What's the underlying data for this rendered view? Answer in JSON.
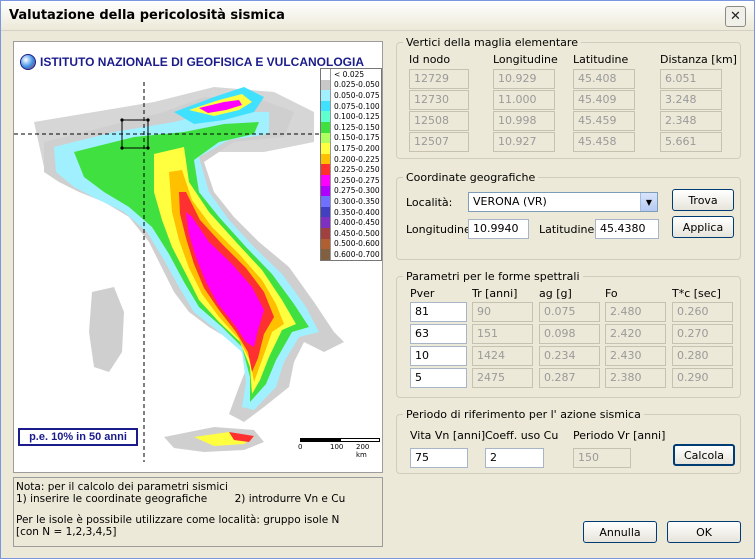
{
  "window": {
    "title": "Valutazione della pericolosità sismica"
  },
  "map": {
    "institute": "ISTITUTO NAZIONALE DI GEOFISICA E VULCANOLOGIA",
    "pe_label": "p.e. 10% in 50 anni",
    "scale_labels": [
      "0",
      "100",
      "200 km"
    ],
    "legend": [
      {
        "label": "< 0.025",
        "color": "#ffffff"
      },
      {
        "label": "0.025-0.050",
        "color": "#c8c8c8"
      },
      {
        "label": "0.050-0.075",
        "color": "#a0f0ff"
      },
      {
        "label": "0.075-0.100",
        "color": "#40e0ff"
      },
      {
        "label": "0.100-0.125",
        "color": "#60ffd0"
      },
      {
        "label": "0.125-0.150",
        "color": "#40e040"
      },
      {
        "label": "0.150-0.175",
        "color": "#b0ff60"
      },
      {
        "label": "0.175-0.200",
        "color": "#ffff40"
      },
      {
        "label": "0.200-0.225",
        "color": "#ffc000"
      },
      {
        "label": "0.225-0.250",
        "color": "#ff3030"
      },
      {
        "label": "0.250-0.275",
        "color": "#ff00ff"
      },
      {
        "label": "0.275-0.300",
        "color": "#b000ff"
      },
      {
        "label": "0.300-0.350",
        "color": "#7070ff"
      },
      {
        "label": "0.350-0.400",
        "color": "#4040c0"
      },
      {
        "label": "0.400-0.450",
        "color": "#8030c0"
      },
      {
        "label": "0.450-0.500",
        "color": "#a04040"
      },
      {
        "label": "0.500-0.600",
        "color": "#b06030"
      },
      {
        "label": "0.600-0.700",
        "color": "#806040"
      }
    ]
  },
  "note": {
    "line1": "Nota: per il calcolo dei parametri sismici",
    "line2a": "1) inserire le coordinate geografiche",
    "line2b": "2) introdurre Vn e Cu",
    "line3": "Per le isole è possibile utilizzare come località: gruppo isole N",
    "line4": "[con N = 1,2,3,4,5]"
  },
  "vertices": {
    "title": "Vertici della maglia elementare",
    "headers": [
      "Id nodo",
      "Longitudine",
      "Latitudine",
      "Distanza [km]"
    ],
    "rows": [
      [
        "12729",
        "10.929",
        "45.408",
        "6.051"
      ],
      [
        "12730",
        "11.000",
        "45.409",
        "3.248"
      ],
      [
        "12508",
        "10.998",
        "45.459",
        "2.348"
      ],
      [
        "12507",
        "10.927",
        "45.458",
        "5.661"
      ]
    ]
  },
  "coords": {
    "title": "Coordinate geografiche",
    "locality_label": "Località:",
    "locality_value": "VERONA (VR)",
    "lon_label": "Longitudine:",
    "lon_value": "10.9940",
    "lat_label": "Latitudine:",
    "lat_value": "45.4380",
    "trova": "Trova",
    "applica": "Applica"
  },
  "spectral": {
    "title": "Parametri per le forme spettrali",
    "headers": [
      "Pver",
      "Tr  [anni]",
      "ag  [g]",
      "Fo",
      "T*c  [sec]"
    ],
    "rows": [
      [
        "81",
        "90",
        "0.075",
        "2.480",
        "0.260"
      ],
      [
        "63",
        "151",
        "0.098",
        "2.420",
        "0.270"
      ],
      [
        "10",
        "1424",
        "0.234",
        "2.430",
        "0.280"
      ],
      [
        "5",
        "2475",
        "0.287",
        "2.380",
        "0.290"
      ]
    ]
  },
  "period": {
    "title": "Periodo di riferimento per l' azione sismica",
    "vn_label": "Vita Vn  [anni]",
    "cu_label": "Coeff. uso Cu",
    "vr_label": "Periodo Vr  [anni]",
    "vn_value": "75",
    "cu_value": "2",
    "vr_value": "150",
    "calcola": "Calcola"
  },
  "footer": {
    "annulla": "Annulla",
    "ok": "OK"
  }
}
